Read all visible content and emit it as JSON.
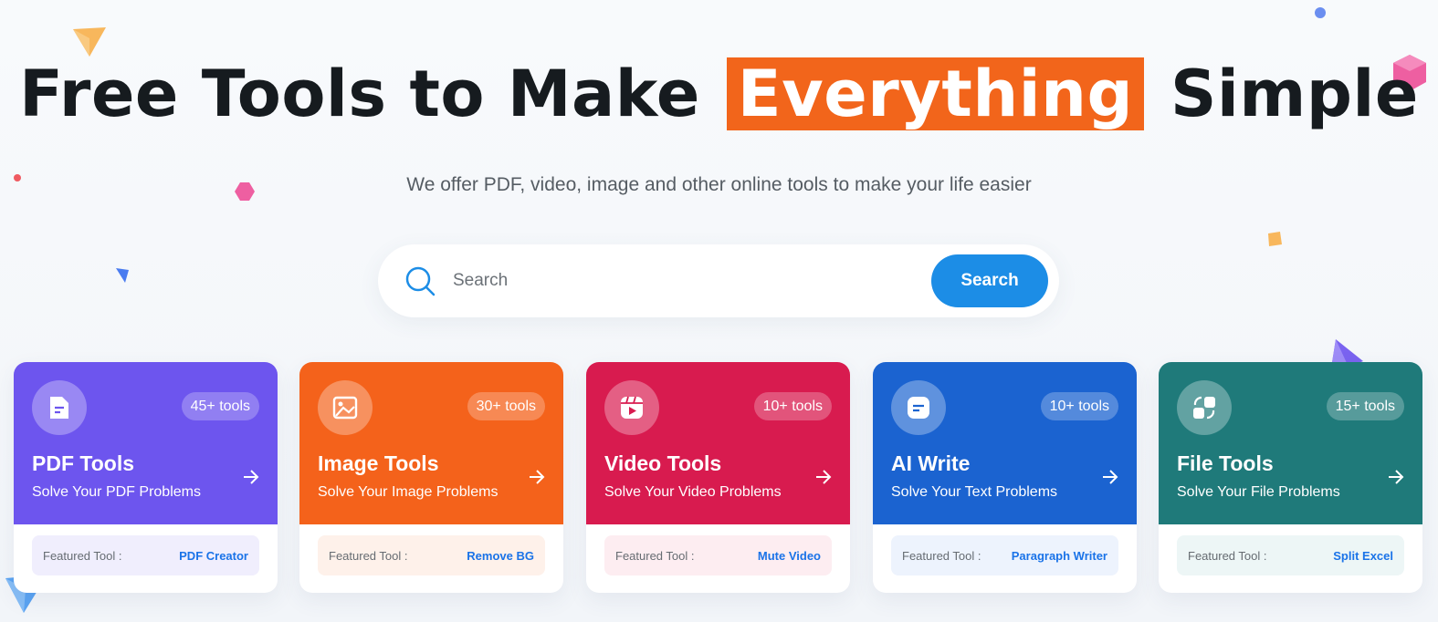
{
  "hero": {
    "title_before": "Free Tools to Make",
    "title_highlight": "Everything",
    "title_after": "Simple",
    "subtitle": "We offer PDF, video, image and other online tools to make your life easier"
  },
  "search": {
    "placeholder": "Search",
    "button_label": "Search"
  },
  "colors": {
    "highlight": "#f2651b",
    "search_button": "#1c8de6",
    "link": "#1a73e8"
  },
  "cards": [
    {
      "title": "PDF Tools",
      "subtitle": "Solve Your PDF Problems",
      "count": "45+ tools",
      "featured_label": "Featured Tool :",
      "featured_tool": "PDF Creator",
      "color": "#6d55ee",
      "icon": "document-icon"
    },
    {
      "title": "Image Tools",
      "subtitle": "Solve Your Image Problems",
      "count": "30+ tools",
      "featured_label": "Featured Tool :",
      "featured_tool": "Remove BG",
      "color": "#f4621b",
      "icon": "image-icon"
    },
    {
      "title": "Video Tools",
      "subtitle": "Solve Your Video Problems",
      "count": "10+ tools",
      "featured_label": "Featured Tool :",
      "featured_tool": "Mute Video",
      "color": "#d81b4f",
      "icon": "video-icon"
    },
    {
      "title": "AI Write",
      "subtitle": "Solve Your Text Problems",
      "count": "10+ tools",
      "featured_label": "Featured Tool :",
      "featured_tool": "Paragraph Writer",
      "color": "#1b63d0",
      "icon": "chat-icon"
    },
    {
      "title": "File Tools",
      "subtitle": "Solve Your File Problems",
      "count": "15+ tools",
      "featured_label": "Featured Tool :",
      "featured_tool": "Split Excel",
      "color": "#1f7a7a",
      "icon": "file-convert-icon"
    }
  ]
}
